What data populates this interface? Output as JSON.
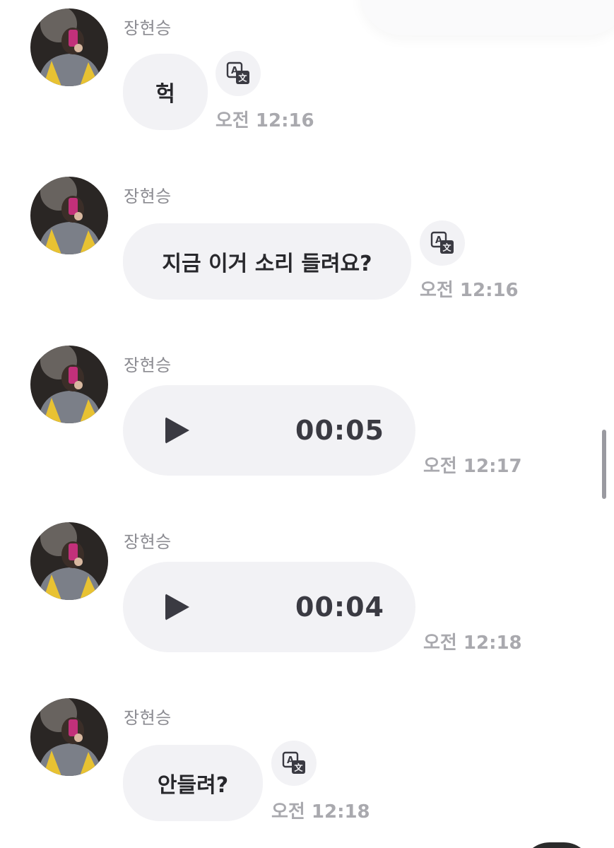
{
  "colors": {
    "bubble_bg": "#f2f2f5",
    "text": "#28282c",
    "sender": "#8b8b91",
    "timestamp": "#a9a9ae",
    "icon": "#3a3a42"
  },
  "icons": {
    "translate": "translate-icon",
    "play": "play-icon",
    "avatar": "profile-photo"
  },
  "messages": [
    {
      "sender": "장현승",
      "type": "text",
      "text": "헉",
      "time": "오전 12:16"
    },
    {
      "sender": "장현승",
      "type": "text",
      "text": "지금 이거 소리 들려요?",
      "time": "오전 12:16"
    },
    {
      "sender": "장현승",
      "type": "voice",
      "duration": "00:05",
      "time": "오전 12:17"
    },
    {
      "sender": "장현승",
      "type": "voice",
      "duration": "00:04",
      "time": "오전 12:18"
    },
    {
      "sender": "장현승",
      "type": "text",
      "text": "안들려?",
      "time": "오전 12:18"
    }
  ]
}
